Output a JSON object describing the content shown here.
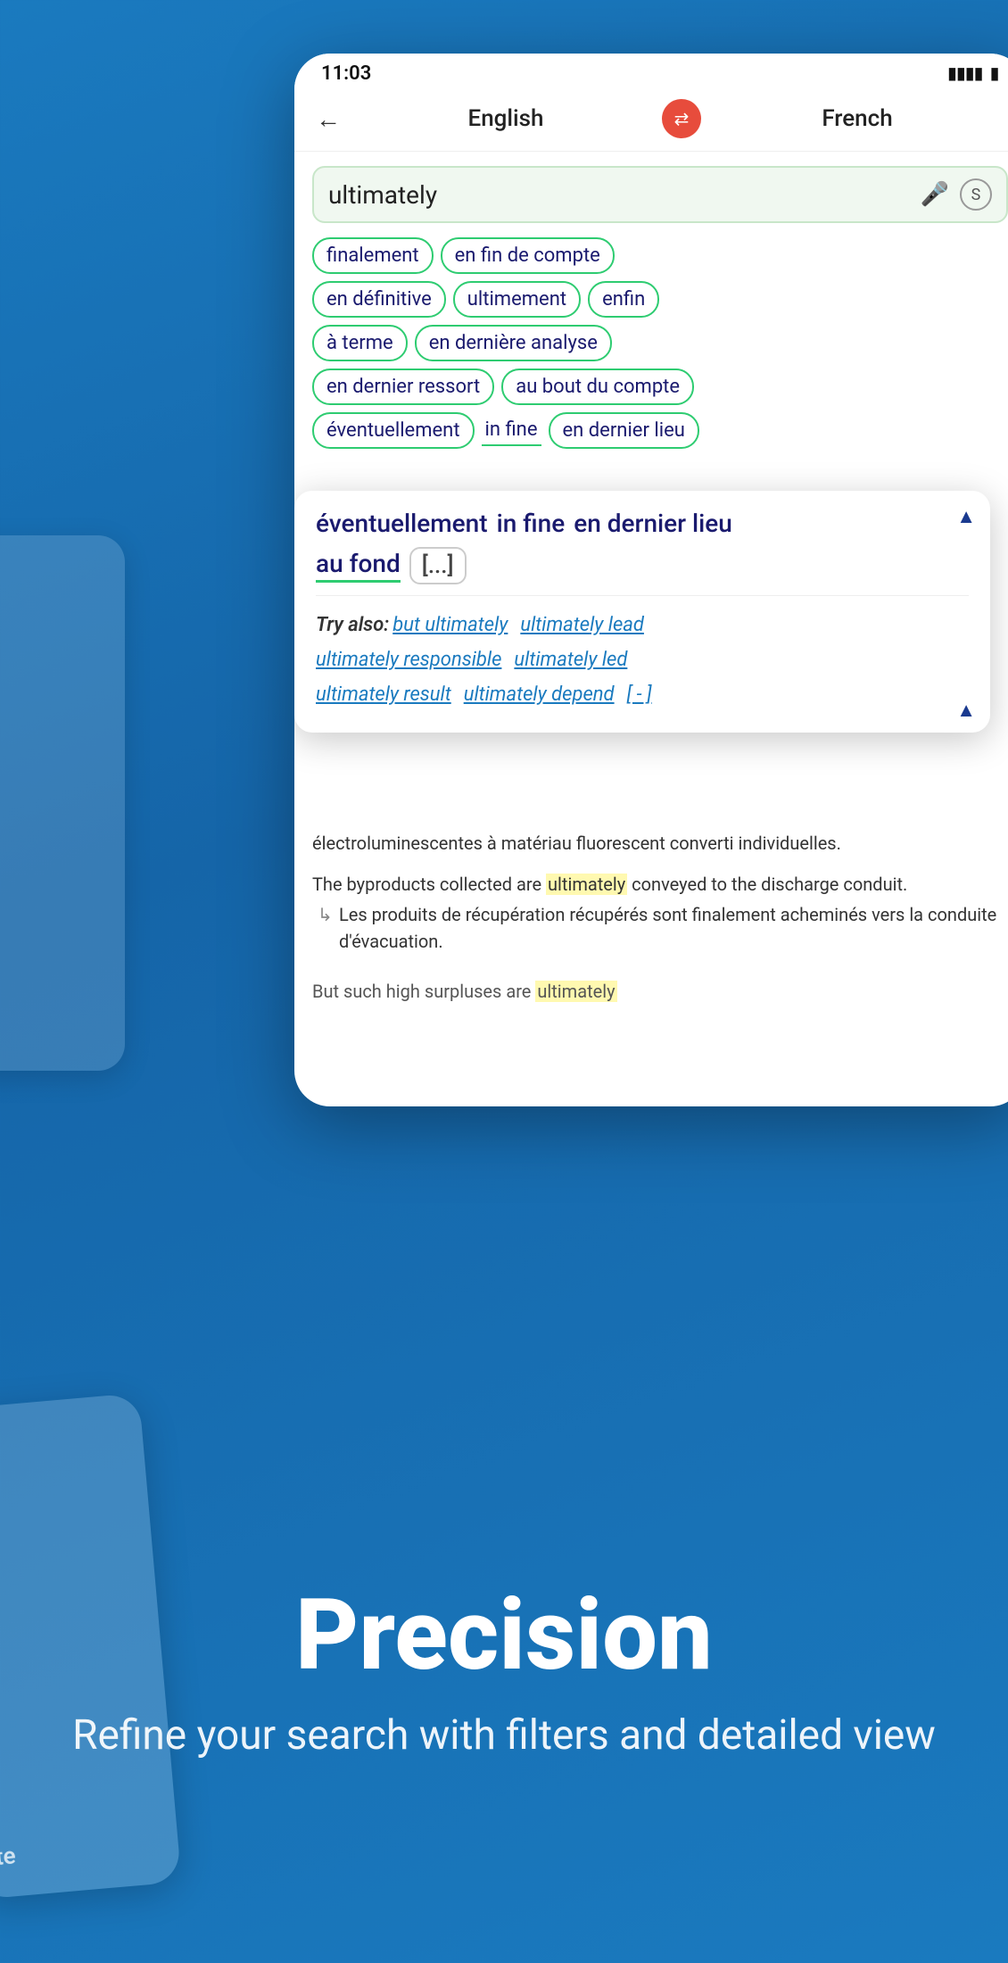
{
  "status_bar": {
    "time": "11:03",
    "signal": "▮▮▮▮",
    "battery": "🔋"
  },
  "header": {
    "back_label": "←",
    "lang_from": "English",
    "swap_icon": "⇄",
    "lang_to": "French"
  },
  "search": {
    "query": "ultimately",
    "mic_label": "🎤",
    "s_icon": "S"
  },
  "chips": {
    "row1": [
      "finalement",
      "en fin de compte"
    ],
    "row2": [
      "en définitive",
      "ultimement",
      "enfin"
    ],
    "row3": [
      "à terme",
      "en dernière analyse"
    ],
    "row4": [
      "en dernier ressort",
      "au bout du compte"
    ],
    "row5": [
      "éventuellement",
      "in fine",
      "en dernier lieu"
    ]
  },
  "expanded_card": {
    "chips": [
      "éventuellement",
      "in fine",
      "en dernier lieu"
    ],
    "chip_au_fond": "au fond",
    "chip_ellipsis": "[...]",
    "collapse_arrow": "▲",
    "try_also_label": "Try also:",
    "links": [
      "but ultimately",
      "ultimately lead",
      "ultimately responsible",
      "ultimately led",
      "ultimately result",
      "ultimately depend",
      "[ - ]"
    ],
    "collapse_arrow_bottom": "▲"
  },
  "examples": {
    "sentence1_en_prefix": "électroluminescentes à matériau",
    "sentence1_en_suffix": "fluorescent converti individuelles.",
    "sentence2_en_prefix": "The byproducts collected are ",
    "sentence2_en_highlight": "ultimately",
    "sentence2_en_suffix": " conveyed to the discharge conduit.",
    "sentence2_fr": "Les produits de récupération récupérés sont finalement acheminés vers la conduite d'évacuation.",
    "sentence3_start": "But such high surpluses are ",
    "sentence3_highlight": "ultimately"
  },
  "bottom_text": {
    "title": "Precision",
    "subtitle": "Refine your search with filters and detailed view"
  },
  "left_phone": {
    "partial_word": "nte"
  }
}
